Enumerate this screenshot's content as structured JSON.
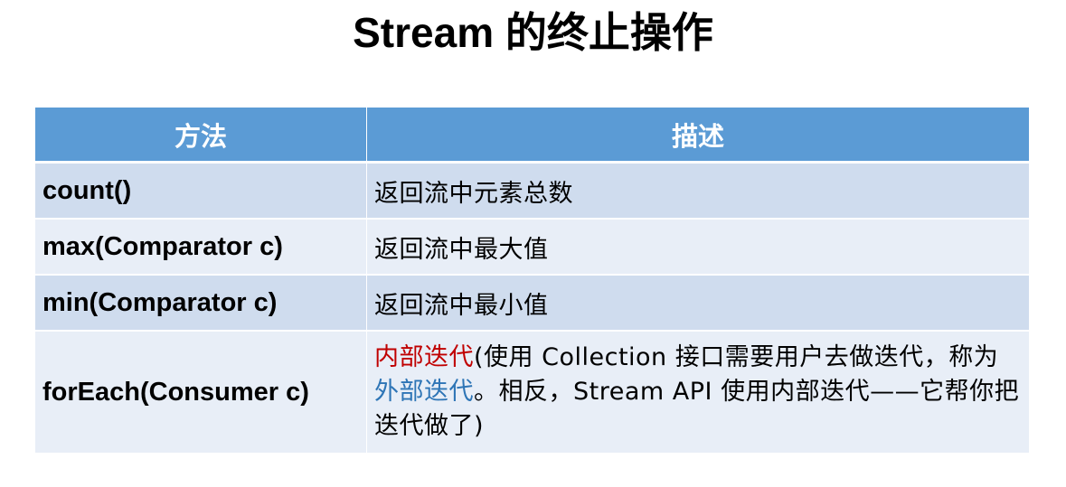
{
  "title": "Stream 的终止操作",
  "table": {
    "headers": [
      "方法",
      "描述"
    ],
    "rows": [
      {
        "method": "count()",
        "description": "返回流中元素总数"
      },
      {
        "method": "max(Comparator c)",
        "description": "返回流中最大值"
      },
      {
        "method": "min(Comparator c)",
        "description": "返回流中最小值"
      },
      {
        "method": "forEach(Consumer c)",
        "description_parts": {
          "red_term": "内部迭代",
          "text1": "(使用 Collection 接口需要用户去做迭代，称为",
          "blue_term": "外部迭代",
          "text2": "。相反，Stream API 使用内部迭代——它帮你把迭代做了)"
        }
      }
    ]
  },
  "colors": {
    "header_bg": "#5b9bd5",
    "row_odd_bg": "#cfdcee",
    "row_even_bg": "#e8eef7",
    "highlight_red": "#c00000",
    "highlight_blue": "#2e75b6"
  }
}
